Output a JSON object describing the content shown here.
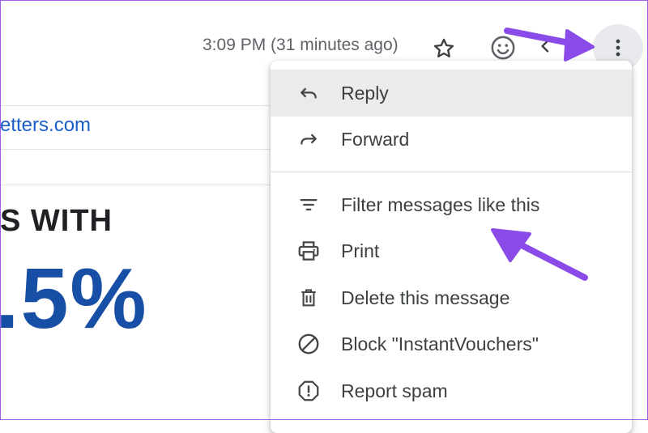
{
  "header": {
    "timestamp": "3:09 PM (31 minutes ago)",
    "icons": [
      "star-icon",
      "emoji-icon",
      "reply-icon",
      "more-vertical-icon"
    ]
  },
  "email": {
    "sender_link": "etters.com",
    "promo_line_1": "S WITH",
    "promo_line_2": ".5%"
  },
  "menu": {
    "items": [
      {
        "label": "Reply",
        "icon": "reply-icon",
        "highlighted": true
      },
      {
        "label": "Forward",
        "icon": "forward-icon"
      },
      {
        "label": "Filter messages like this",
        "icon": "filter-icon"
      },
      {
        "label": "Print",
        "icon": "print-icon"
      },
      {
        "label": "Delete this message",
        "icon": "trash-icon"
      },
      {
        "label": "Block \"InstantVouchers\"",
        "icon": "block-icon"
      },
      {
        "label": "Report spam",
        "icon": "report-spam-icon"
      }
    ]
  },
  "colors": {
    "annotation_arrow": "#8a4be8",
    "link": "#1a5fc8",
    "promo_blue": "#174ea6",
    "menu_highlight": "#ebebeb"
  }
}
